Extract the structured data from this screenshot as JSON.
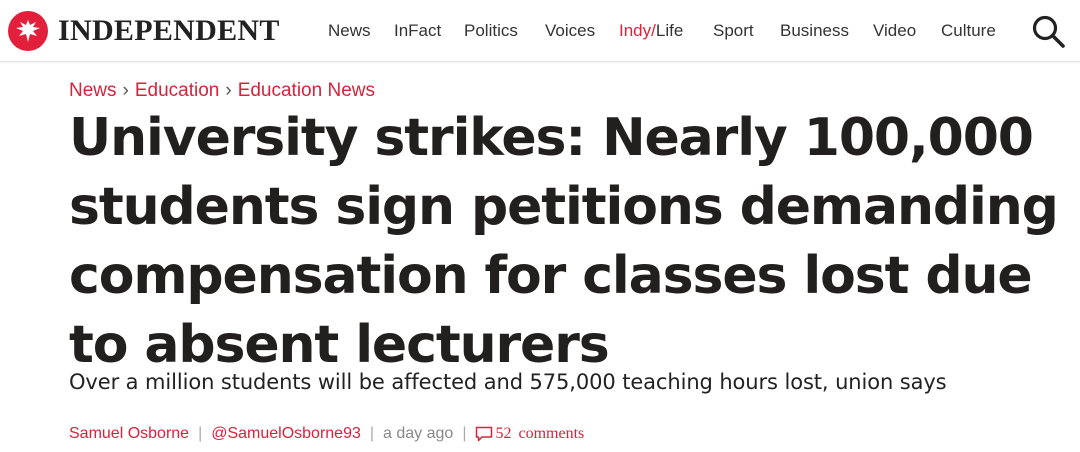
{
  "header": {
    "logo_text": "INDEPENDENT",
    "nav": [
      {
        "label": "News"
      },
      {
        "label": "InFact"
      },
      {
        "label": "Politics"
      },
      {
        "label": "Voices"
      },
      {
        "label_a": "Indy/",
        "label_b": "Life"
      },
      {
        "label": "Sport"
      },
      {
        "label": "Business"
      },
      {
        "label": "Video"
      },
      {
        "label": "Culture"
      }
    ]
  },
  "breadcrumb": [
    "News",
    "Education",
    "Education News"
  ],
  "article": {
    "headline": "University strikes: Nearly 100,000 students sign petitions demanding compensation for classes lost due to absent lecturers",
    "standfirst": "Over a million students will be affected and 575,000 teaching hours lost, union says",
    "author": "Samuel Osborne",
    "author_handle": "@SamuelOsborne93",
    "time": "a day ago",
    "comments_count": "52",
    "comments_label": "comments"
  },
  "colors": {
    "brand_red": "#e3203b",
    "text": "#221f1f"
  },
  "icons": {
    "logo": "eagle-icon",
    "search": "search-icon",
    "comments": "comment-bubble-icon"
  }
}
